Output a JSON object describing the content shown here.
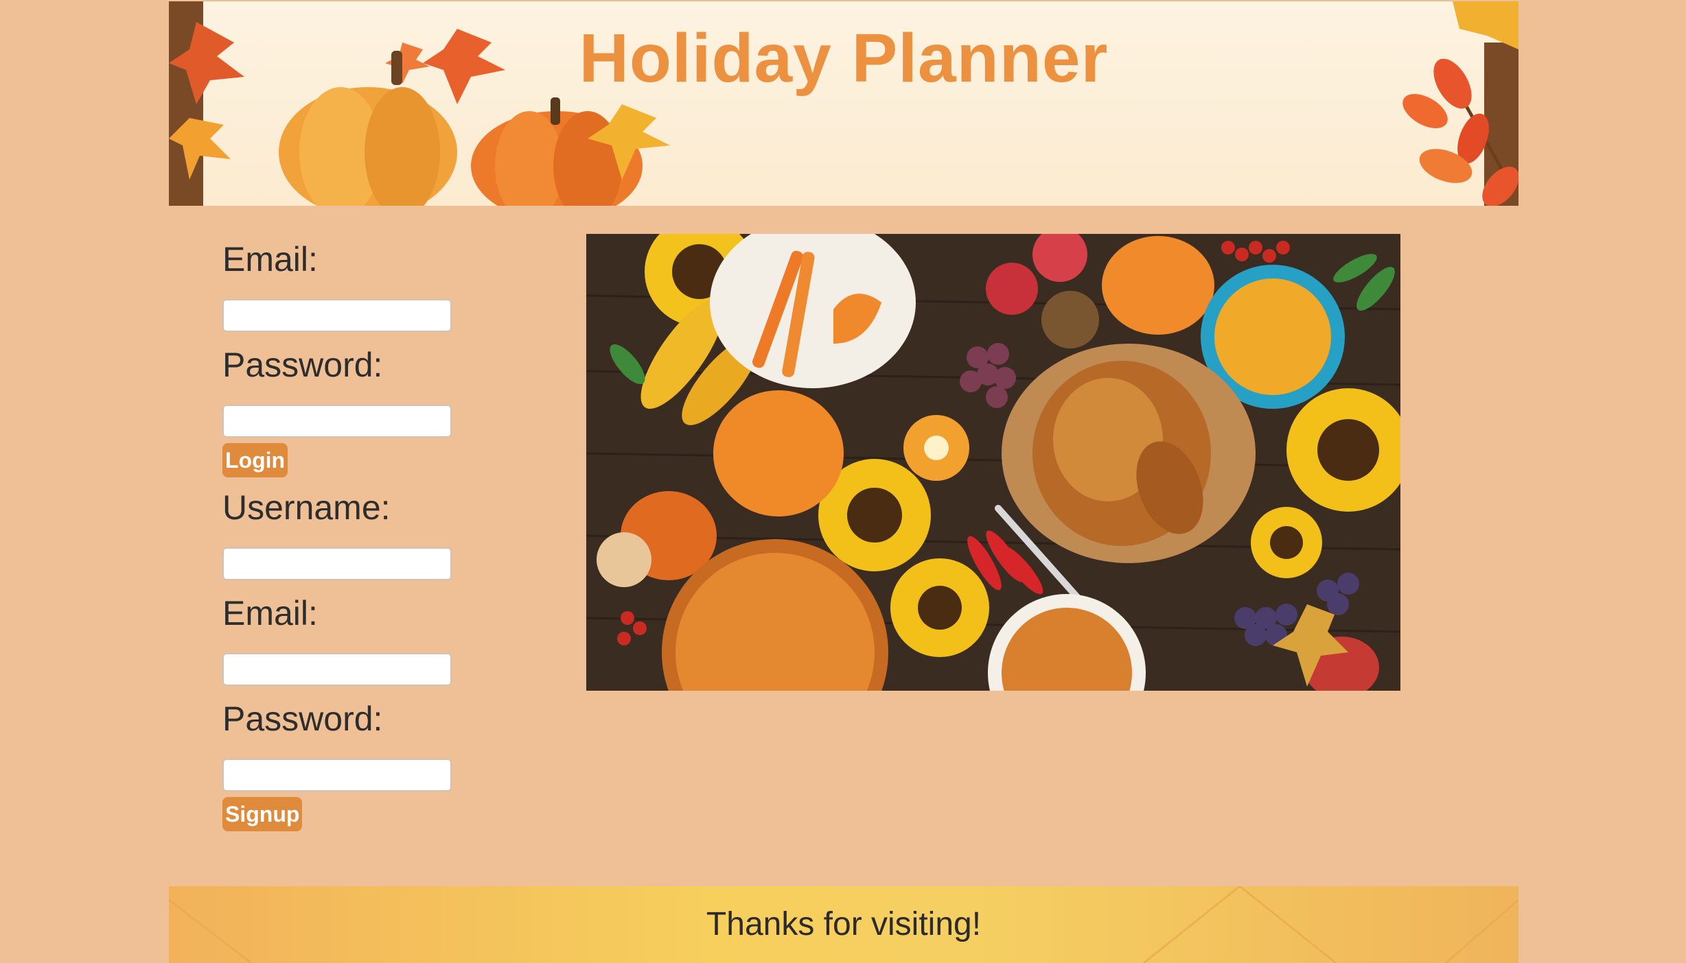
{
  "header": {
    "title": "Holiday Planner"
  },
  "login": {
    "email_label": "Email:",
    "email_value": "",
    "password_label": "Password:",
    "password_value": "",
    "button_label": "Login"
  },
  "signup": {
    "username_label": "Username:",
    "username_value": "",
    "email_label": "Email:",
    "email_value": "",
    "password_label": "Password:",
    "password_value": "",
    "button_label": "Signup"
  },
  "hero": {
    "icons": [
      "sunflower-icon",
      "pumpkin-icon",
      "roast-turkey-icon",
      "pie-icon",
      "corn-icon",
      "candle-icon",
      "soup-bowl-icon"
    ]
  },
  "footer": {
    "text": "Thanks for visiting!"
  },
  "colors": {
    "background": "#efc096",
    "accent": "#ec9140",
    "button": "#e08a3c",
    "footer": "#f6cf5d"
  }
}
